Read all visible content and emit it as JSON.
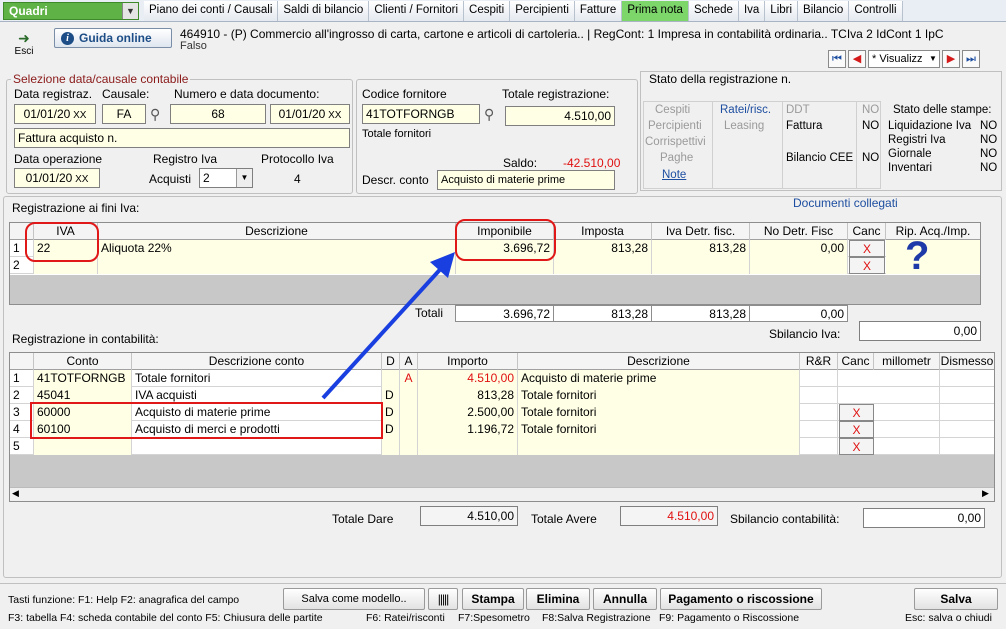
{
  "module": "Quadri",
  "menu": [
    "Piano dei conti / Causali",
    "Saldi di bilancio",
    "Clienti / Fornitori",
    "Cespiti",
    "Percipienti",
    "Fatture",
    "Prima nota",
    "Schede",
    "Iva",
    "Libri",
    "Bilancio",
    "Controlli"
  ],
  "active_menu": "Prima nota",
  "esci_label": "Esci",
  "guida_label": "Guida online",
  "company_line": "464910 - (P) Commercio all'ingrosso di carta, cartone e articoli di cartoleria.. | RegCont: 1 Impresa  in contabilità ordinaria..  TCIva 2 IdCont 1 IpC",
  "company_line2": "Falso",
  "nav_select": "* Visualizz",
  "selezione": {
    "legend": "Selezione data/causale contabile",
    "data_reg_label": "Data registraz.",
    "data_reg": "01/01/20",
    "causale_label": "Causale:",
    "causale": "FA",
    "numdata_label": "Numero e data documento:",
    "numero": "68",
    "data_doc": "01/01/20",
    "descrizione": "Fattura acquisto n.",
    "data_op_label": "Data operazione",
    "data_op": "01/01/20",
    "registro_label": "Registro Iva",
    "registro_name": "Acquisti",
    "registro_val": "2",
    "protocollo_label": "Protocollo Iva",
    "protocollo": "4",
    "fornitore_label": "Codice fornitore",
    "fornitore": "41TOTFORNGB",
    "fornitore_desc": "Totale fornitori",
    "totale_label": "Totale registrazione:",
    "totale": "4.510,00",
    "saldo_label": "Saldo:",
    "saldo": "-42.510,00",
    "descr_conto_label": "Descr. conto",
    "descr_conto": "Acquisto di materie prime"
  },
  "stato": {
    "title": "Stato della registrazione n.",
    "cespiti": "Cespiti",
    "ratei": "Ratei/risc.",
    "ddt": "DDT",
    "ddt_val": "NO",
    "percipienti": "Percipienti",
    "leasing": "Leasing",
    "fattura": "Fattura",
    "fattura_val": "NO",
    "corrispettivi": "Corrispettivi",
    "paghe": "Paghe",
    "bilancio": "Bilancio CEE",
    "bilancio_val": "NO",
    "note": "Note",
    "stampe_title": "Stato delle stampe:",
    "stampe": [
      {
        "k": "Liquidazione Iva",
        "v": "NO"
      },
      {
        "k": "Registri Iva",
        "v": "NO"
      },
      {
        "k": "Giornale",
        "v": "NO"
      },
      {
        "k": "Inventari",
        "v": "NO"
      }
    ]
  },
  "documenti": "Documenti collegati",
  "iva": {
    "title": "Registrazione ai fini Iva:",
    "headers": [
      "IVA",
      "Descrizione",
      "Imponibile",
      "Imposta",
      "Iva Detr. fisc.",
      "No Detr. Fisc",
      "Canc",
      "Rip. Acq./Imp."
    ],
    "rows": [
      {
        "n": "1",
        "iva": "22",
        "desc": "Aliquota 22%",
        "imp": "3.696,72",
        "imposta": "813,28",
        "detr": "813,28",
        "nodetr": "0,00"
      },
      {
        "n": "2",
        "iva": "",
        "desc": "",
        "imp": "",
        "imposta": "",
        "detr": "",
        "nodetr": ""
      }
    ],
    "totali_label": "Totali",
    "tot_imp": "3.696,72",
    "tot_imposta": "813,28",
    "tot_detr": "813,28",
    "tot_nodetr": "0,00",
    "sbilancio_label": "Sbilancio Iva:",
    "sbilancio": "0,00",
    "canc_x": "X",
    "question": "?"
  },
  "cont": {
    "title": "Registrazione in contabilità:",
    "headers": [
      "Conto",
      "Descrizione conto",
      "D",
      "A",
      "Importo",
      "Descrizione",
      "R&R",
      "Canc",
      "millometr",
      "Dismesso"
    ],
    "rows": [
      {
        "n": "1",
        "conto": "41TOTFORNGB",
        "desc": "Totale fornitori",
        "d": "",
        "a": "A",
        "imp": "4.510,00",
        "descr": "Acquisto di materie prime"
      },
      {
        "n": "2",
        "conto": "45041",
        "desc": "IVA acquisti",
        "d": "D",
        "a": "",
        "imp": "813,28",
        "descr": "Totale fornitori"
      },
      {
        "n": "3",
        "conto": "60000",
        "desc": "Acquisto di materie prime",
        "d": "D",
        "a": "",
        "imp": "2.500,00",
        "descr": "Totale fornitori"
      },
      {
        "n": "4",
        "conto": "60100",
        "desc": "Acquisto di merci e prodotti",
        "d": "D",
        "a": "",
        "imp": "1.196,72",
        "descr": "Totale fornitori"
      },
      {
        "n": "5",
        "conto": "",
        "desc": "",
        "d": "",
        "a": "",
        "imp": "",
        "descr": ""
      }
    ],
    "tot_dare_label": "Totale Dare",
    "tot_dare": "4.510,00",
    "tot_avere_label": "Totale Avere",
    "tot_avere": "4.510,00",
    "sbil_label": "Sbilancio contabilità:",
    "sbil": "0,00"
  },
  "footer": {
    "tasti": "Tasti funzione:  F1: Help  F2: anagrafica del campo",
    "line2": "F3: tabella   F4: scheda contabile del conto  F5: Chiusura delle partite",
    "f6": "F6: Ratei/risconti",
    "f7": "F7:Spesometro",
    "f8": "F8:Salva Registrazione",
    "f9": "F9: Pagamento o Riscossione",
    "esc": "Esc: salva o chiudi",
    "salva_modello": "Salva come modello..",
    "stampa": "Stampa",
    "elimina": "Elimina",
    "annulla": "Annulla",
    "pagamento": "Pagamento o riscossione",
    "salva": "Salva"
  }
}
